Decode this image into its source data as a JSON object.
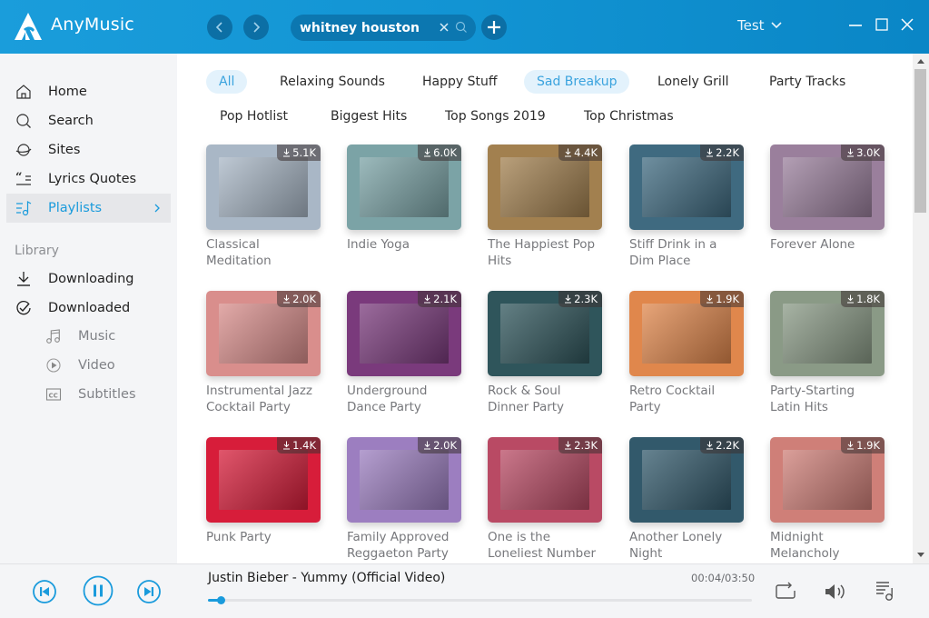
{
  "app": {
    "title": "AnyMusic",
    "accent_color": "#1a9bdc"
  },
  "titlebar": {
    "search_value": "whitney houston",
    "search_placeholder": "Search",
    "account_name": "Test",
    "icons": {
      "back": "chevron-left-icon",
      "forward": "chevron-right-icon",
      "clear": "close-icon",
      "search": "search-icon",
      "add": "plus-icon",
      "account_dropdown": "chevron-down-icon",
      "minimize": "minimize-icon",
      "maximize": "maximize-icon",
      "close": "close-icon"
    }
  },
  "sidebar": {
    "items": [
      {
        "label": "Home",
        "icon": "home-icon"
      },
      {
        "label": "Search",
        "icon": "search-icon"
      },
      {
        "label": "Sites",
        "icon": "planet-icon"
      },
      {
        "label": "Lyrics Quotes",
        "icon": "quote-icon"
      },
      {
        "label": "Playlists",
        "icon": "playlist-icon",
        "active": true
      }
    ],
    "library_label": "Library",
    "library_items": [
      {
        "label": "Downloading",
        "icon": "download-icon"
      },
      {
        "label": "Downloaded",
        "icon": "check-circle-icon"
      }
    ],
    "downloaded_sub_items": [
      {
        "label": "Music",
        "icon": "music-note-icon"
      },
      {
        "label": "Video",
        "icon": "play-circle-icon"
      },
      {
        "label": "Subtitles",
        "icon": "cc-icon"
      }
    ]
  },
  "categories": {
    "row1": [
      "All",
      "Relaxing Sounds",
      "Happy Stuff",
      "Sad Breakup",
      "Lonely Grill",
      "Party Tracks"
    ],
    "row2": [
      "Pop Hotlist",
      "Biggest Hits",
      "Top Songs 2019",
      "Top Christmas"
    ],
    "active": [
      "All",
      "Sad Breakup"
    ]
  },
  "playlists": [
    {
      "title": "Classical Meditation",
      "downloads": "5.1K",
      "color": "#a9b7c6"
    },
    {
      "title": "Indie Yoga",
      "downloads": "6.0K",
      "color": "#7ba3a6"
    },
    {
      "title": "The Happiest Pop Hits",
      "downloads": "4.4K",
      "color": "#a2804f"
    },
    {
      "title": "Stiff Drink in a Dim Place",
      "downloads": "2.2K",
      "color": "#3f6a80"
    },
    {
      "title": "Forever Alone",
      "downloads": "3.0K",
      "color": "#9a7f9c"
    },
    {
      "title": "Instrumental Jazz Cocktail Party",
      "downloads": "2.0K",
      "color": "#d98e8c"
    },
    {
      "title": "Underground Dance Party",
      "downloads": "2.1K",
      "color": "#7a3a7c"
    },
    {
      "title": "Rock & Soul Dinner Party",
      "downloads": "2.3K",
      "color": "#2f555b"
    },
    {
      "title": "Retro Cocktail Party",
      "downloads": "1.9K",
      "color": "#e0874c"
    },
    {
      "title": "Party-Starting Latin Hits",
      "downloads": "1.8K",
      "color": "#8a9a86"
    },
    {
      "title": "Punk Party",
      "downloads": "1.4K",
      "color": "#d71d3a"
    },
    {
      "title": "Family Approved Reggaeton Party",
      "downloads": "2.0K",
      "color": "#9c7ec0"
    },
    {
      "title": "One is the Loneliest Number",
      "downloads": "2.3K",
      "color": "#b94a64"
    },
    {
      "title": "Another Lonely Night",
      "downloads": "2.2K",
      "color": "#32596b"
    },
    {
      "title": "Midnight Melancholy",
      "downloads": "1.9K",
      "color": "#cf7f78"
    }
  ],
  "player": {
    "track_title": "Justin Bieber - Yummy (Official Video)",
    "time": "00:04/03:50",
    "progress_fraction": 0.017,
    "state": "playing",
    "icons": {
      "previous": "skip-previous-icon",
      "pause": "pause-icon",
      "next": "skip-next-icon",
      "repeat": "repeat-icon",
      "volume": "volume-icon",
      "queue": "queue-music-icon"
    }
  }
}
